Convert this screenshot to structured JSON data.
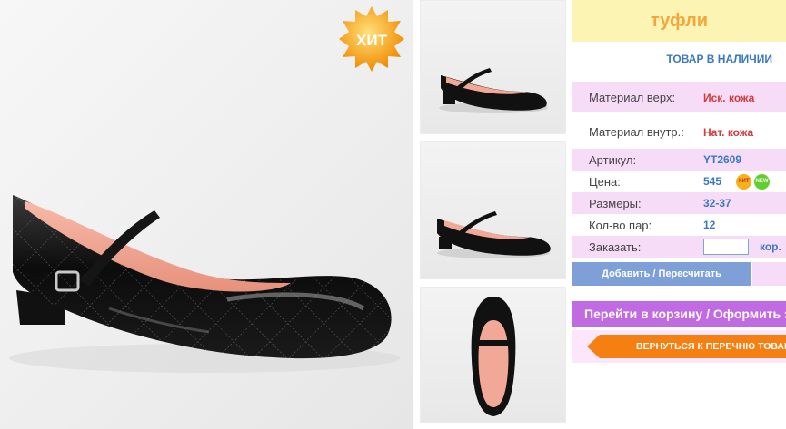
{
  "product": {
    "title": "туфли",
    "availability": "ТОВАР В НАЛИЧИИ",
    "hit_badge": "ХИТ",
    "mini_badges": {
      "hit": "ХИТ",
      "new": "NEW"
    }
  },
  "details": {
    "material_top_label": "Материал верх:",
    "material_top_value": "Иск. кожа",
    "material_inner_label": "Материал внутр.:",
    "material_inner_value": "Нат. кожа",
    "sku_label": "Артикул:",
    "sku_value": "YT2609",
    "price_label": "Цена:",
    "price_value": "545",
    "sizes_label": "Размеры:",
    "sizes_value": "32-37",
    "pairs_label": "Кол-во пар:",
    "pairs_value": "12",
    "order_label": "Заказать:",
    "order_input_value": "",
    "order_unit": "кор."
  },
  "actions": {
    "add_button": "Добавить / Пересчитать",
    "cart_button": "Перейти в корзину / Оформить заказ",
    "back_button": "ВЕРНУТЬСЯ К ПЕРЕЧНЮ ТОВАРОВ"
  },
  "colors": {
    "title_bg": "#fbf4b3",
    "title_text": "#f4a53c",
    "pink_row": "#f6dcf6",
    "blue_text": "#3b78c3",
    "red_text": "#d43a3a",
    "add_button_bg": "#7e9fd8",
    "cart_button_bg": "#c06be2",
    "back_button_bg": "#f57f10"
  },
  "icons": [
    "hit-starburst-icon",
    "hit-mini-icon",
    "new-mini-icon",
    "back-arrow-icon"
  ]
}
